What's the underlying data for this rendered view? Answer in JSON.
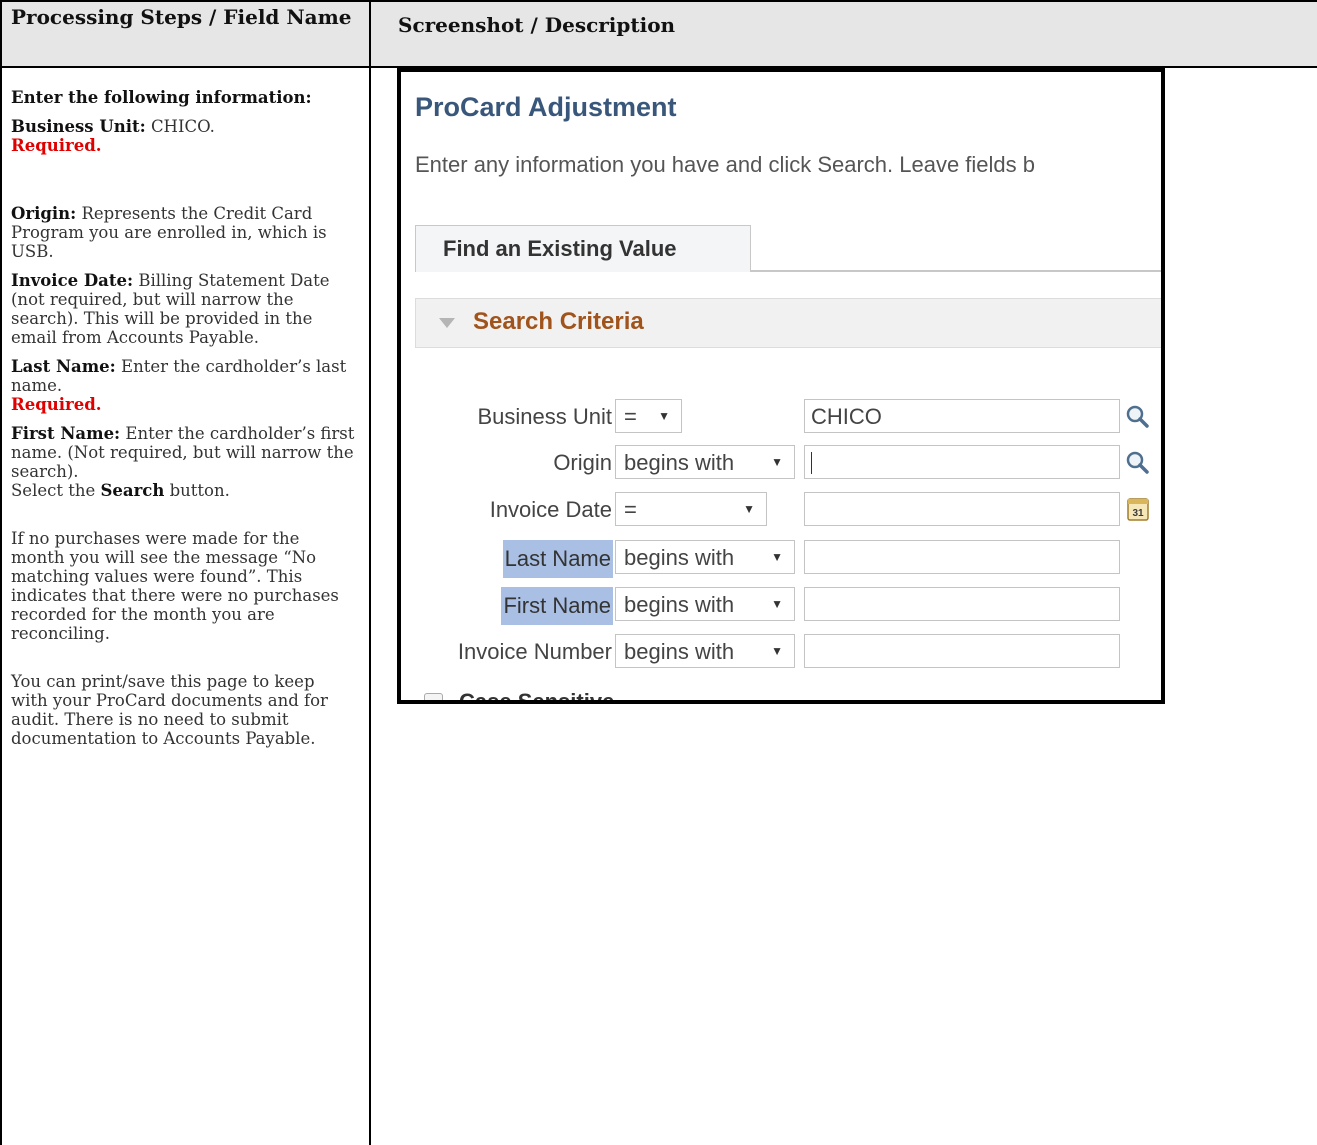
{
  "table": {
    "header_left": "Processing Steps / Field Name",
    "header_right": "Screenshot / Description"
  },
  "instructions": {
    "intro": "Enter the following information:",
    "business_unit_label": "Business Unit:",
    "business_unit_text": "CHICO.",
    "required": "Required.",
    "origin_label": "Origin:",
    "origin_text": "Represents the Credit Card Program you are enrolled in, which is USB.",
    "invoice_date_label": "Invoice Date:",
    "invoice_date_text": "Billing Statement Date (not required, but will narrow the search). This will be provided in the email from Accounts Payable.",
    "last_name_label": "Last Name:",
    "last_name_text": "Enter the cardholder’s last name.",
    "first_name_label": "First Name:",
    "first_name_text": "Enter the cardholder’s first name. (Not required, but will narrow the search).",
    "select_prefix": "Select the",
    "search_word": "Search",
    "select_suffix": "button.",
    "no_purchases_text": "If no purchases were made for the month you will see the message “No matching values were found”. This indicates that there were no purchases recorded for the month you are reconciling.",
    "print_text": "You can print/save this page to keep with your ProCard documents and for audit. There is no need to submit documentation to Accounts Payable."
  },
  "screenshot": {
    "title": "ProCard Adjustment",
    "instruction": "Enter any information you have and click Search. Leave fields b",
    "tab_label": "Find an Existing Value",
    "section_label": "Search Criteria",
    "fields": [
      {
        "label": "Business Unit",
        "operator": "=",
        "value": "CHICO",
        "icon": "magnifier-icon",
        "highlight": false
      },
      {
        "label": "Origin",
        "operator": "begins with",
        "value": "",
        "icon": "magnifier-icon",
        "highlight": false
      },
      {
        "label": "Invoice Date",
        "operator": "=",
        "value": "",
        "icon": "calendar-icon",
        "highlight": false
      },
      {
        "label": "Last Name",
        "operator": "begins with",
        "value": "",
        "icon": "",
        "highlight": true
      },
      {
        "label": "First Name",
        "operator": "begins with",
        "value": "",
        "icon": "",
        "highlight": true
      },
      {
        "label": "Invoice Number",
        "operator": "begins with",
        "value": "",
        "icon": "",
        "highlight": false
      }
    ],
    "calendar_day": "31",
    "case_sensitive_label": "Case Sensitive"
  },
  "colors": {
    "required": "#e00000",
    "title_blue": "#39577a",
    "section_orange": "#a0531b",
    "label_highlight": "#a9c0e4"
  }
}
